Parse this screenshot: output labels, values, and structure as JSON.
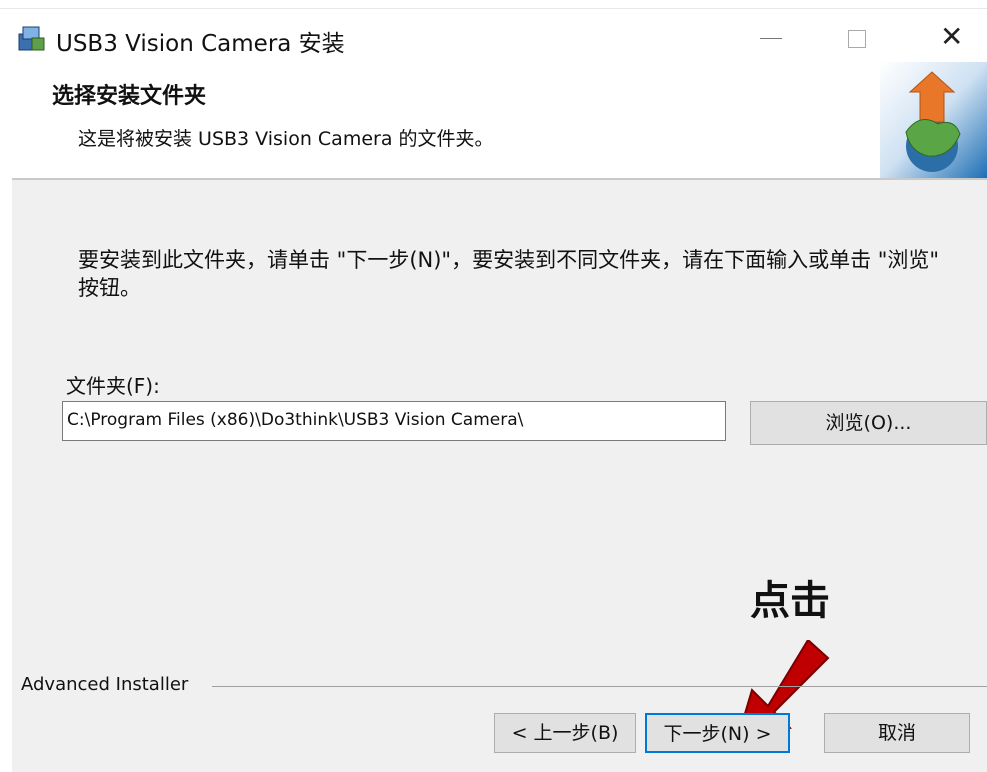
{
  "window": {
    "title": "USB3 Vision Camera 安装",
    "controls": {
      "minimize": "—",
      "close": "✕"
    }
  },
  "header": {
    "title": "选择安装文件夹",
    "subtitle": "这是将被安装 USB3 Vision Camera 的文件夹。"
  },
  "body": {
    "description": "要安装到此文件夹，请单击 \"下一步(N)\"，要安装到不同文件夹，请在下面输入或单击 \"浏览\" 按钮。",
    "folder_label": "文件夹(F):",
    "folder_path": "C:\\Program Files (x86)\\Do3think\\USB3 Vision Camera\\",
    "browse_label": "浏览(O)..."
  },
  "annotation": {
    "callout": "点击",
    "color": "#c00000"
  },
  "footer": {
    "brand": "Advanced Installer",
    "back_label": "< 上一步(B)",
    "next_label": "下一步(N) >",
    "cancel_label": "取消"
  }
}
